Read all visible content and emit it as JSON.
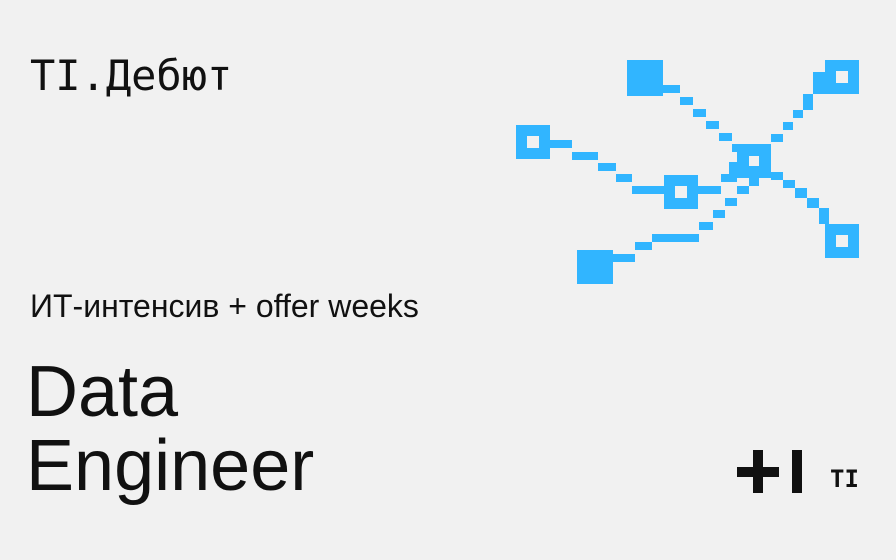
{
  "header": {
    "brand": "TI.Дебют"
  },
  "hero": {
    "subtitle": "ИТ-интенсив + offer weeks",
    "title_line1": "Data",
    "title_line2": "Engineer"
  },
  "footer": {
    "logo_text": "TI"
  },
  "icons": {
    "network": "network-graph-icon",
    "plus_bar": "plus-bar-logo-icon"
  },
  "colors": {
    "background": "#f1f1f1",
    "text": "#111111",
    "accent": "#31b5ff"
  }
}
